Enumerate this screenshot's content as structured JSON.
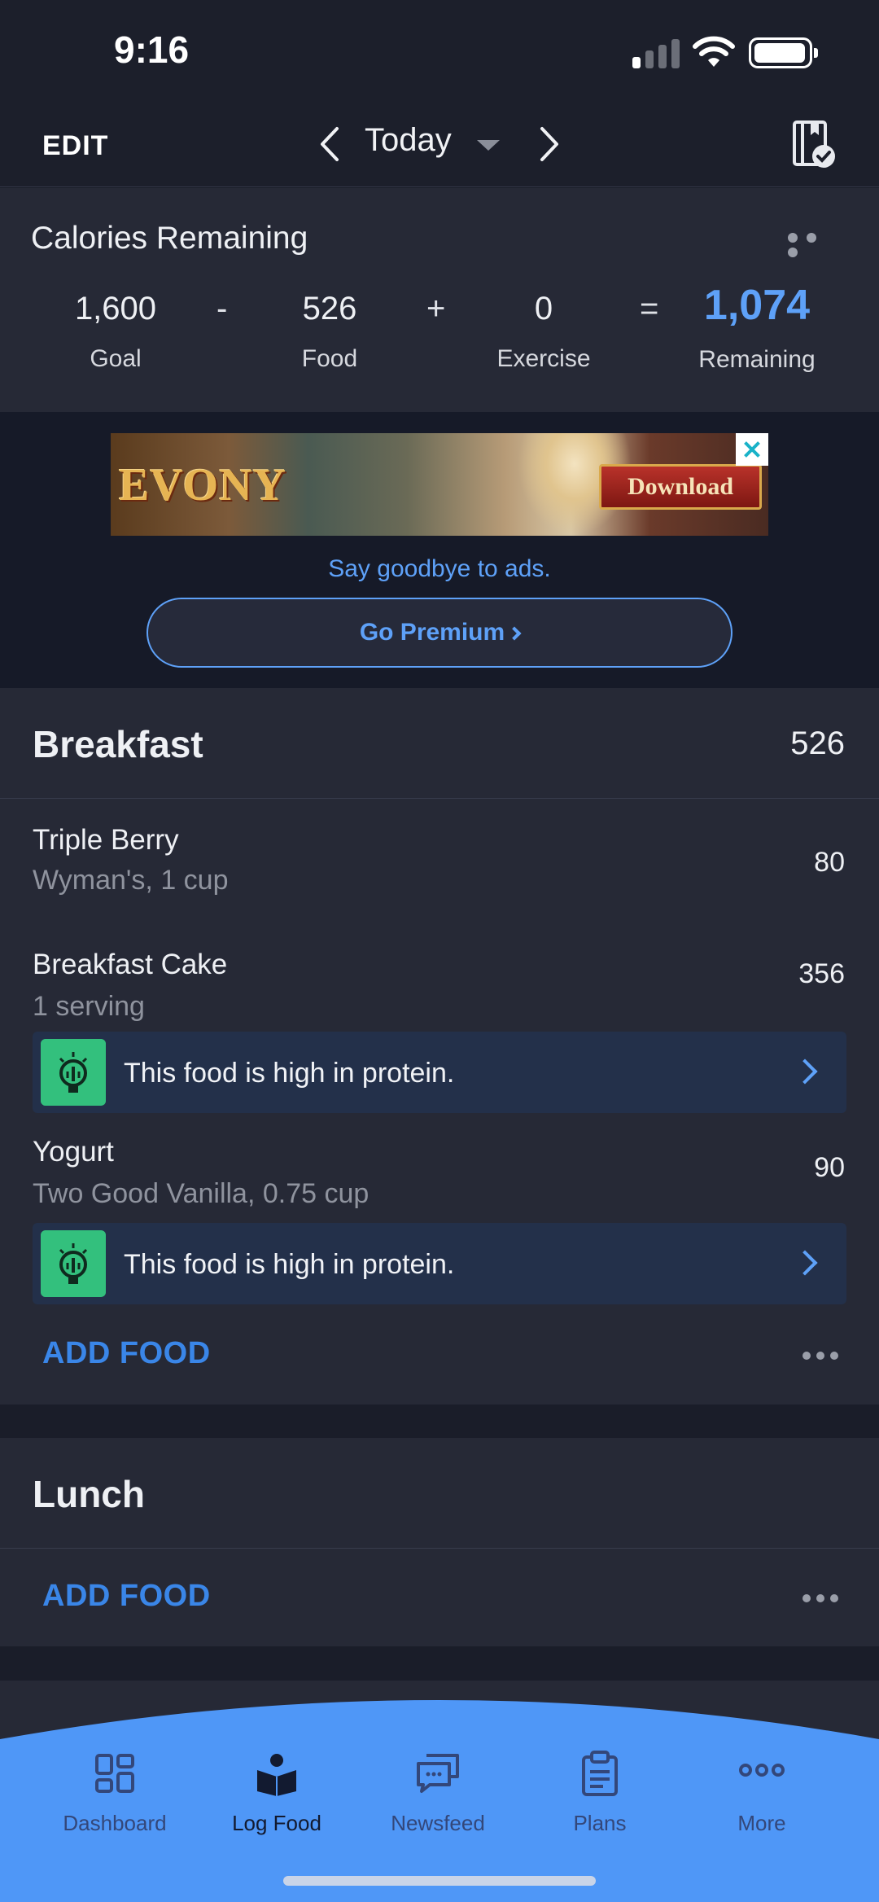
{
  "status_bar": {
    "time": "9:16"
  },
  "nav": {
    "edit_label": "EDIT",
    "date_label": "Today"
  },
  "calories": {
    "title": "Calories Remaining",
    "goal": {
      "value": "1,600",
      "label": "Goal"
    },
    "minus": "-",
    "food": {
      "value": "526",
      "label": "Food"
    },
    "plus": "+",
    "exercise": {
      "value": "0",
      "label": "Exercise"
    },
    "equals": "=",
    "remaining": {
      "value": "1,074",
      "label": "Remaining"
    }
  },
  "ad": {
    "brand": "EVONY",
    "cta": "Download",
    "goodbye_text": "Say goodbye to ads.",
    "premium_label": "Go Premium"
  },
  "breakfast": {
    "title": "Breakfast",
    "total": "526",
    "items": [
      {
        "name": "Triple Berry",
        "detail": "Wyman's, 1 cup",
        "calories": "80"
      },
      {
        "name": "Breakfast Cake",
        "detail": "1 serving",
        "calories": "356",
        "tip": "This food is high in protein."
      },
      {
        "name": "Yogurt",
        "detail": "Two Good Vanilla, 0.75 cup",
        "calories": "90",
        "tip": "This food is high in protein."
      }
    ],
    "add_label": "ADD FOOD"
  },
  "lunch": {
    "title": "Lunch",
    "add_label": "ADD FOOD"
  },
  "tabs": [
    {
      "label": "Dashboard",
      "icon": "grid-icon"
    },
    {
      "label": "Log Food",
      "icon": "book-person-icon",
      "active": true
    },
    {
      "label": "Newsfeed",
      "icon": "chat-bubbles-icon"
    },
    {
      "label": "Plans",
      "icon": "clipboard-icon"
    },
    {
      "label": "More",
      "icon": "more-dots-icon"
    }
  ],
  "colors": {
    "accent": "#5ea1f8",
    "tab_bar": "#4f97f7",
    "tip_icon": "#33c07d"
  }
}
